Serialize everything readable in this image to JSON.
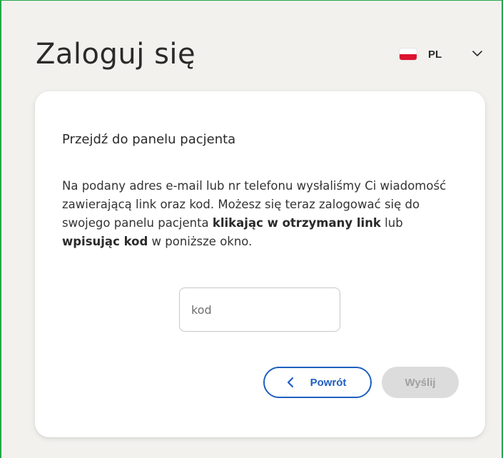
{
  "header": {
    "title": "Zaloguj się",
    "language": {
      "code": "PL",
      "flag_icon": "poland-flag-icon",
      "dropdown_icon": "chevron-down-icon"
    }
  },
  "card": {
    "heading": "Przejdź do panelu pacjenta",
    "description": {
      "part1": "Na podany adres e-mail lub nr telefonu wysłaliśmy Ci wiadomość zawierającą link oraz kod. Możesz się teraz zalogować się do swojego panelu pacjenta ",
      "bold1": "klikając w otrzymany link",
      "part2": " lub ",
      "bold2": "wpisując kod",
      "part3": " w poniższe okno."
    },
    "code_input": {
      "placeholder": "kod",
      "value": ""
    },
    "buttons": {
      "back_label": "Powrót",
      "back_icon": "chevron-left-icon",
      "send_label": "Wyślij",
      "send_disabled": true
    }
  },
  "colors": {
    "background": "#f2f1ee",
    "card": "#ffffff",
    "accent_blue": "#1f5fbf",
    "disabled_bg": "#dcdcdc",
    "disabled_text": "#a0a0a0",
    "flag_red": "#dc1430",
    "frame_green": "#22a845"
  }
}
